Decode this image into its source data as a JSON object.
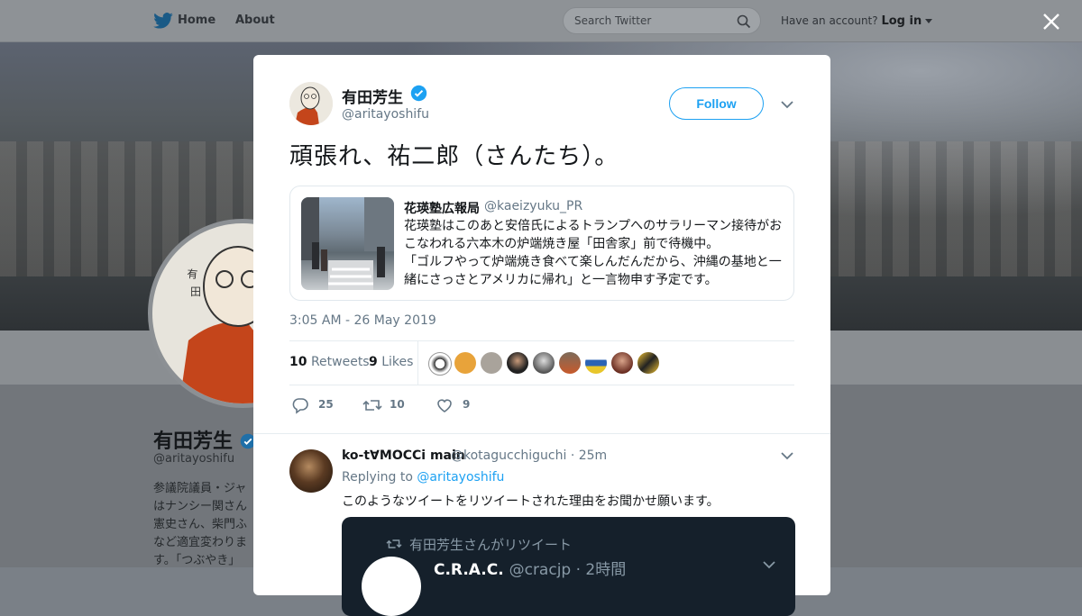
{
  "nav": {
    "home": "Home",
    "about": "About",
    "search_placeholder": "Search Twitter",
    "have_account": "Have an account?",
    "login": "Log in"
  },
  "background_profile": {
    "name": "有田芳生",
    "handle": "@aritayoshifu",
    "bio_lines": [
      "参議院議員・ジャ",
      "はナンシー関さん",
      "憲史さん、柴門ふ",
      "など適宜変わりま",
      "す。「つぶやき」"
    ]
  },
  "tweet": {
    "author_name": "有田芳生",
    "author_handle": "@aritayoshifu",
    "follow_label": "Follow",
    "text": "頑張れ、祐二郎（さんたち）。",
    "quoted": {
      "name": "花瑛塾広報局",
      "handle": "@kaeizyuku_PR",
      "lines": [
        "花瑛塾はこのあと安倍氏によるトランプへのサラリーマン接待がお",
        "こなわれる六本木の炉端焼き屋「田舎家」前で待機中。",
        "「ゴルフやって炉端焼き食べて楽しんだんだから、沖縄の基地と一",
        "緒にさっさとアメリカに帰れ」と一言物申す予定です。"
      ]
    },
    "timestamp": "3:05 AM - 26 May 2019",
    "retweets_count": "10",
    "retweets_label": "Retweets",
    "likes_count": "9",
    "likes_label": "Likes",
    "actions": {
      "replies": "25",
      "retweets": "10",
      "likes": "9"
    }
  },
  "reply": {
    "name": "ko-t∀MOCCi main",
    "handle": "@kotagucchiguchi",
    "time": "· 25m",
    "replying_to_prefix": "Replying to",
    "replying_to_handle": "@aritayoshifu",
    "text": "このようなツイートをリツイートされた理由をお聞かせ願います。",
    "media_retweet_line": "有田芳生さんがリツイート",
    "media_second_line_name": "C.R.A.C.",
    "media_second_line_rest": "@cracjp · 2時間"
  },
  "colors": {
    "accent": "#1da1f2",
    "text_primary": "#14171a",
    "text_secondary": "#657786"
  }
}
